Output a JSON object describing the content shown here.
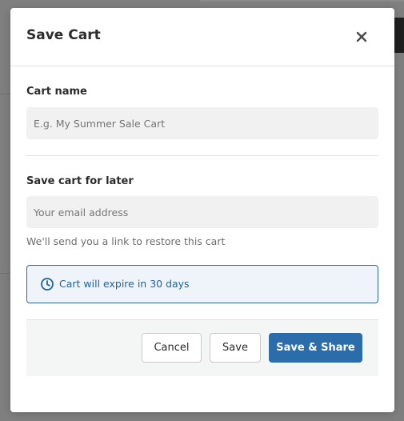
{
  "modal": {
    "title": "Save Cart",
    "close_icon": "close-icon"
  },
  "cart_name": {
    "label": "Cart name",
    "value": "",
    "placeholder": "E.g. My Summer Sale Cart"
  },
  "save_later": {
    "label": "Save cart for later",
    "value": "",
    "placeholder": "Your email address",
    "helper": "We'll send you a link to restore this cart"
  },
  "info": {
    "icon": "clock-icon",
    "text": "Cart will expire in 30 days"
  },
  "footer": {
    "cancel_label": "Cancel",
    "save_label": "Save",
    "share_label": "Save & Share"
  },
  "colors": {
    "primary": "#2b6cab",
    "info_border": "#2b6a9c",
    "info_background": "#eef4fa",
    "input_background": "#f1f1f1",
    "backdrop": "#7f7f7f"
  }
}
